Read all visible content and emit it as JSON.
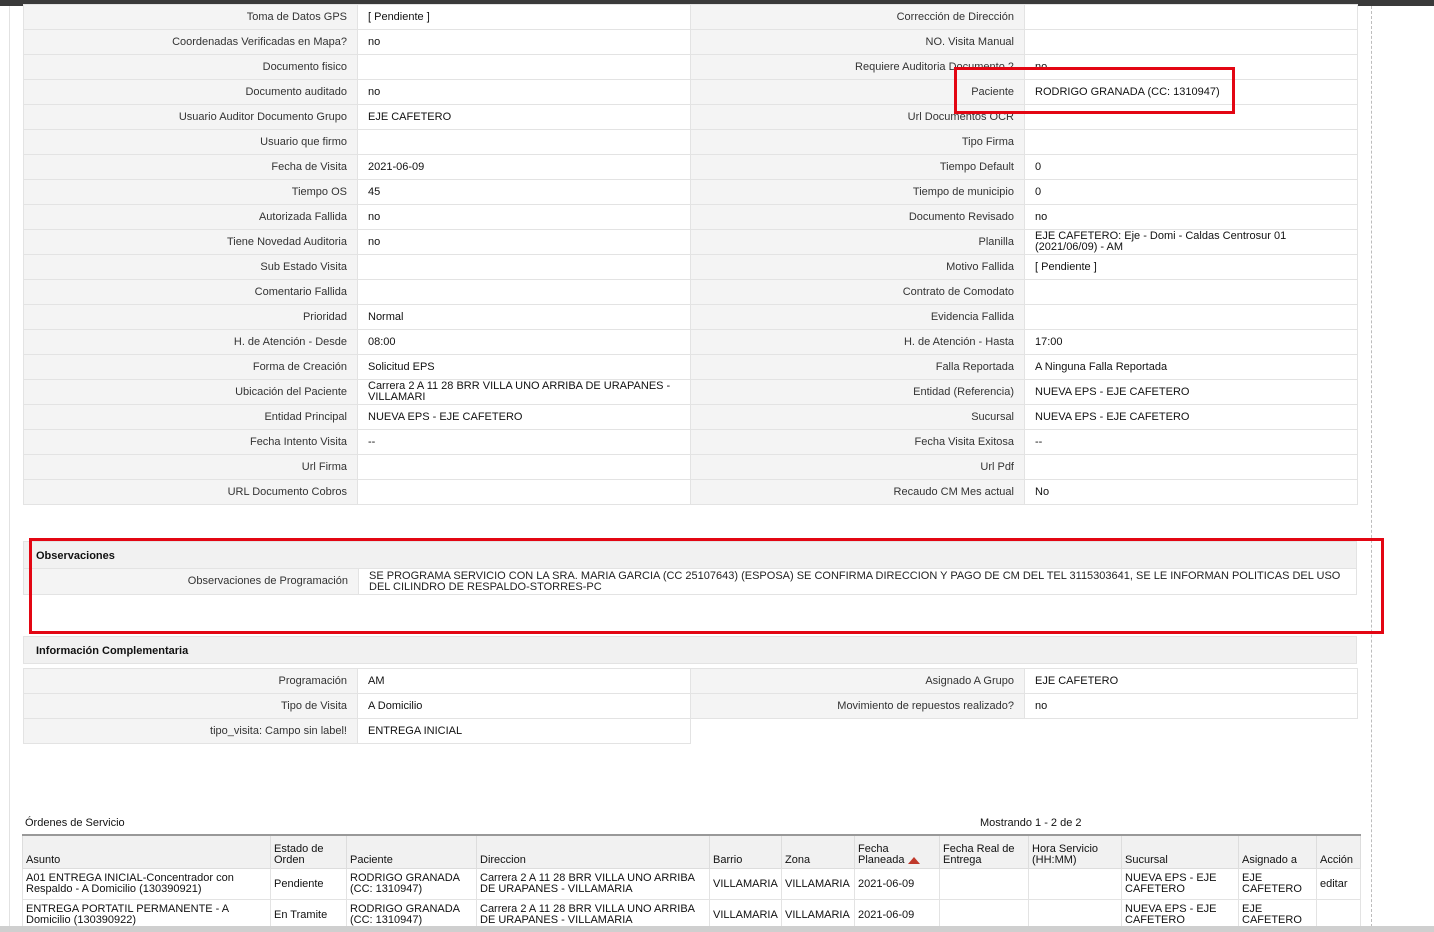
{
  "colors": {
    "highlight": "#e30613",
    "label_bg": "#f4f4f4",
    "header_bg": "#f1f1f1"
  },
  "details": [
    [
      "Toma de Datos GPS",
      "[ Pendiente ]",
      "Corrección de Dirección",
      ""
    ],
    [
      "Coordenadas Verificadas en Mapa?",
      "no",
      "NO. Visita Manual",
      ""
    ],
    [
      "Documento fisico",
      "",
      "Requiere Auditoria Documento 2",
      "no"
    ],
    [
      "Documento auditado",
      "no",
      "Paciente",
      "RODRIGO GRANADA (CC: 1310947)"
    ],
    [
      "Usuario Auditor Documento Grupo",
      "EJE CAFETERO",
      "Url Documentos OCR",
      ""
    ],
    [
      "Usuario que firmo",
      "",
      "Tipo Firma",
      ""
    ],
    [
      "Fecha de Visita",
      "2021-06-09",
      "Tiempo Default",
      "0"
    ],
    [
      "Tiempo OS",
      "45",
      "Tiempo de municipio",
      "0"
    ],
    [
      "Autorizada Fallida",
      "no",
      "Documento Revisado",
      "no"
    ],
    [
      "Tiene Novedad Auditoria",
      "no",
      "Planilla",
      "EJE CAFETERO: Eje - Domi - Caldas Centrosur 01 (2021/06/09) - AM"
    ],
    [
      "Sub Estado Visita",
      "",
      "Motivo Fallida",
      "[ Pendiente ]"
    ],
    [
      "Comentario Fallida",
      "",
      "Contrato de Comodato",
      ""
    ],
    [
      "Prioridad",
      "Normal",
      "Evidencia Fallida",
      ""
    ],
    [
      "H. de Atención - Desde",
      "08:00",
      "H. de Atención - Hasta",
      "17:00"
    ],
    [
      "Forma de Creación",
      "Solicitud EPS",
      "Falla Reportada",
      "A Ninguna Falla Reportada"
    ],
    [
      "Ubicación del Paciente",
      "Carrera 2 A 11 28 BRR VILLA UNO ARRIBA DE URAPANES - VILLAMARI",
      "Entidad (Referencia)",
      "NUEVA EPS - EJE CAFETERO"
    ],
    [
      "Entidad Principal",
      "NUEVA EPS - EJE CAFETERO",
      "Sucursal",
      "NUEVA EPS - EJE CAFETERO"
    ],
    [
      "Fecha Intento Visita",
      "--",
      "Fecha Visita Exitosa",
      "--"
    ],
    [
      "Url Firma",
      "",
      "Url Pdf",
      ""
    ],
    [
      "URL Documento Cobros",
      "",
      "Recaudo CM Mes actual",
      "No"
    ]
  ],
  "observaciones": {
    "title": "Observaciones",
    "label": "Observaciones de Programación",
    "value": "SE PROGRAMA SERVICIO CON LA SRA. MARIA GARCIA (CC 25107643) (ESPOSA) SE CONFIRMA DIRECCION Y PAGO DE CM DEL TEL 3115303641, SE LE INFORMAN POLITICAS DEL USO DEL CILINDRO DE RESPALDO-STORRES-PC"
  },
  "complementaria": {
    "title": "Información Complementaria",
    "rows": [
      [
        "Programación",
        "AM",
        "Asignado A Grupo",
        "EJE CAFETERO"
      ],
      [
        "Tipo de Visita",
        "A Domicilio",
        "Movimiento de repuestos realizado?",
        "no"
      ],
      [
        "tipo_visita: Campo sin label!",
        "ENTREGA INICIAL",
        "",
        ""
      ]
    ]
  },
  "orders": {
    "title": "Órdenes de Servicio",
    "count": "Mostrando 1 - 2 de 2",
    "headers": [
      "Asunto",
      "Estado de Orden",
      "Paciente",
      "Direccion",
      "Barrio",
      "Zona",
      "Fecha Planeada",
      "Fecha Real de Entrega",
      "Hora Servicio (HH:MM)",
      "Sucursal",
      "Asignado a",
      "Acción"
    ],
    "rows": [
      [
        "A01 ENTREGA INICIAL-Concentrador con Respaldo - A Domicilio (130390921)",
        "Pendiente",
        "RODRIGO GRANADA (CC: 1310947)",
        "Carrera 2 A 11 28 BRR VILLA UNO ARRIBA DE URAPANES - VILLAMARIA",
        "VILLAMARIA",
        "VILLAMARIA",
        "2021-06-09",
        "",
        "",
        "NUEVA EPS - EJE CAFETERO",
        "EJE CAFETERO",
        "editar"
      ],
      [
        "ENTREGA PORTATIL PERMANENTE - A Domicilio (130390922)",
        "En Tramite",
        "RODRIGO GRANADA (CC: 1310947)",
        "Carrera 2 A 11 28 BRR VILLA UNO ARRIBA DE URAPANES - VILLAMARIA",
        "VILLAMARIA",
        "VILLAMARIA",
        "2021-06-09",
        "",
        "",
        "NUEVA EPS - EJE CAFETERO",
        "EJE CAFETERO",
        ""
      ]
    ]
  }
}
